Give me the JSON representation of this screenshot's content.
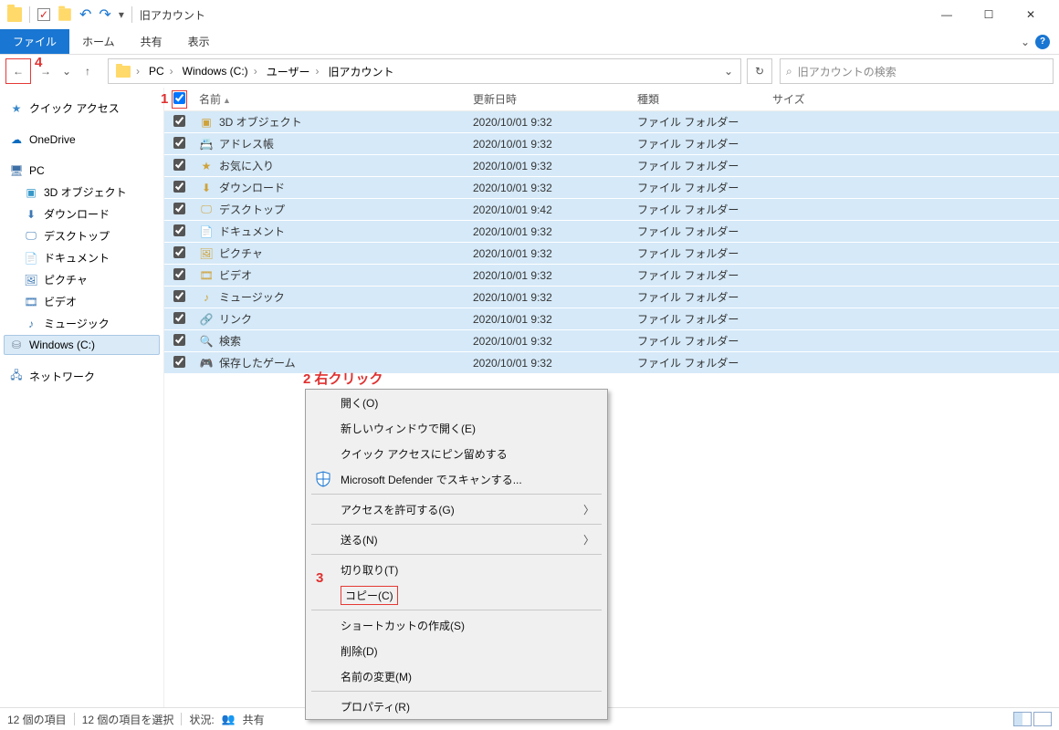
{
  "window": {
    "title": "旧アカウント"
  },
  "tabs": {
    "file": "ファイル",
    "home": "ホーム",
    "share": "共有",
    "view": "表示"
  },
  "breadcrumb": {
    "pc": "PC",
    "drive": "Windows (C:)",
    "users": "ユーザー",
    "folder": "旧アカウント"
  },
  "search": {
    "placeholder": "旧アカウントの検索"
  },
  "sidebar": {
    "quick": "クイック アクセス",
    "onedrive": "OneDrive",
    "pc": "PC",
    "obj3d": "3D オブジェクト",
    "downloads": "ダウンロード",
    "desktop": "デスクトップ",
    "documents": "ドキュメント",
    "pictures": "ピクチャ",
    "videos": "ビデオ",
    "music": "ミュージック",
    "windowsc": "Windows (C:)",
    "network": "ネットワーク"
  },
  "columns": {
    "name": "名前",
    "date": "更新日時",
    "type": "種類",
    "size": "サイズ"
  },
  "common": {
    "type": "ファイル フォルダー"
  },
  "rows": [
    {
      "name": "3D オブジェクト",
      "date": "2020/10/01 9:32"
    },
    {
      "name": "アドレス帳",
      "date": "2020/10/01 9:32"
    },
    {
      "name": "お気に入り",
      "date": "2020/10/01 9:32"
    },
    {
      "name": "ダウンロード",
      "date": "2020/10/01 9:32"
    },
    {
      "name": "デスクトップ",
      "date": "2020/10/01 9:42"
    },
    {
      "name": "ドキュメント",
      "date": "2020/10/01 9:32"
    },
    {
      "name": "ピクチャ",
      "date": "2020/10/01 9:32"
    },
    {
      "name": "ビデオ",
      "date": "2020/10/01 9:32"
    },
    {
      "name": "ミュージック",
      "date": "2020/10/01 9:32"
    },
    {
      "name": "リンク",
      "date": "2020/10/01 9:32"
    },
    {
      "name": "検索",
      "date": "2020/10/01 9:32"
    },
    {
      "name": "保存したゲーム",
      "date": "2020/10/01 9:32"
    }
  ],
  "menu": {
    "open": "開く(O)",
    "open_new": "新しいウィンドウで開く(E)",
    "pin": "クイック アクセスにピン留めする",
    "defender": "Microsoft Defender でスキャンする...",
    "access": "アクセスを許可する(G)",
    "send": "送る(N)",
    "cut": "切り取り(T)",
    "copy": "コピー(C)",
    "shortcut": "ショートカットの作成(S)",
    "delete": "削除(D)",
    "rename": "名前の変更(M)",
    "properties": "プロパティ(R)"
  },
  "status": {
    "count": "12 個の項目",
    "selected": "12 個の項目を選択",
    "state_label": "状況:",
    "state": "共有"
  },
  "annotations": {
    "a1": "1",
    "a2": "2 右クリック",
    "a3": "3",
    "a4": "4"
  }
}
